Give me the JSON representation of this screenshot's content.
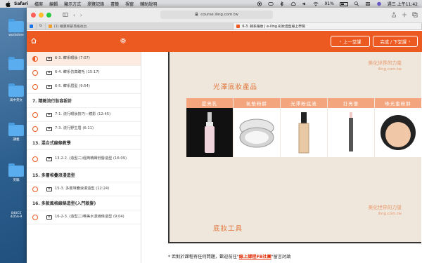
{
  "menubar": {
    "app": "Safari",
    "items": [
      "檔案",
      "編輯",
      "顯示方式",
      "瀏覽記錄",
      "書籤",
      "視窗",
      "輔助說明"
    ],
    "battery": "91%",
    "clock": "週三 上午11:42"
  },
  "desktop": {
    "icons": [
      "workshee",
      "",
      "",
      "高中英文",
      "",
      "講義",
      "",
      "英稿",
      "",
      "040C5\n4D5A-9"
    ]
  },
  "browser": {
    "url": "course.iling.com.tw",
    "tabs": [
      {
        "label": "",
        "active": false
      },
      {
        "label": "G",
        "active": false
      },
      {
        "label": "(1) 櫃賣師部落格後台",
        "active": false
      },
      {
        "label": "6-3. 韓系眼妝 | e-iling 彩妝造型線上學院",
        "active": true
      }
    ]
  },
  "course": {
    "prev_label": "上一堂課",
    "next_label": "完成 / 下堂課",
    "lessons": [
      {
        "type": "lesson",
        "label": "6-3. 韓系眼妝 (7:07)",
        "current": true
      },
      {
        "type": "lesson",
        "label": "6-4. 韓系仿真睫毛 (15:17)"
      },
      {
        "type": "lesson",
        "label": "6-5. 韓系眉型 (9:54)"
      },
      {
        "type": "section",
        "label": "7. 精緻流行妝容設計"
      },
      {
        "type": "lesson",
        "label": "7-1. 流行眼妝技巧—鏡影 (12:45)"
      },
      {
        "type": "lesson",
        "label": "7-3. 流行野生眉 (6:11)"
      },
      {
        "type": "section",
        "label": "13. 混合式線條教學"
      },
      {
        "type": "lesson",
        "label": "13-2-2. (造型二)經典精緻低髻造型 (16:09)",
        "tall": true
      },
      {
        "type": "section",
        "label": "15. 多層堆疊浪漫造型"
      },
      {
        "type": "lesson",
        "label": "15-3. 多層堆疊浪漫造型 (12:24)"
      },
      {
        "type": "section",
        "label": "16. 多款風格線條造型(入門款髮)"
      },
      {
        "type": "lesson",
        "label": "16-2-3. (造型二)唯美水漾線條造型 (9:04)"
      }
    ]
  },
  "slide": {
    "brand_top": "美化世界的力量",
    "brand_url_top": "iling.com.tw",
    "title1": "光澤底妝產品",
    "products": [
      "提亮乳",
      "氣墊粉餅",
      "光澤粉底液",
      "打亮筆",
      "珠光蜜粉餅"
    ],
    "brand_bottom": "美化世界的力量",
    "brand_url_bottom": "iling.com.tw",
    "title2": "底妝工具"
  },
  "footer": {
    "prefix": "* 若對於課程有任何問題，歡迎前往\"",
    "link": "線上課程FB社團",
    "suffix": "\"留言討論"
  },
  "colors": {
    "accent": "#ec5a22",
    "product_header": "#f3a57e",
    "slide_bg": "#efe6dc"
  }
}
